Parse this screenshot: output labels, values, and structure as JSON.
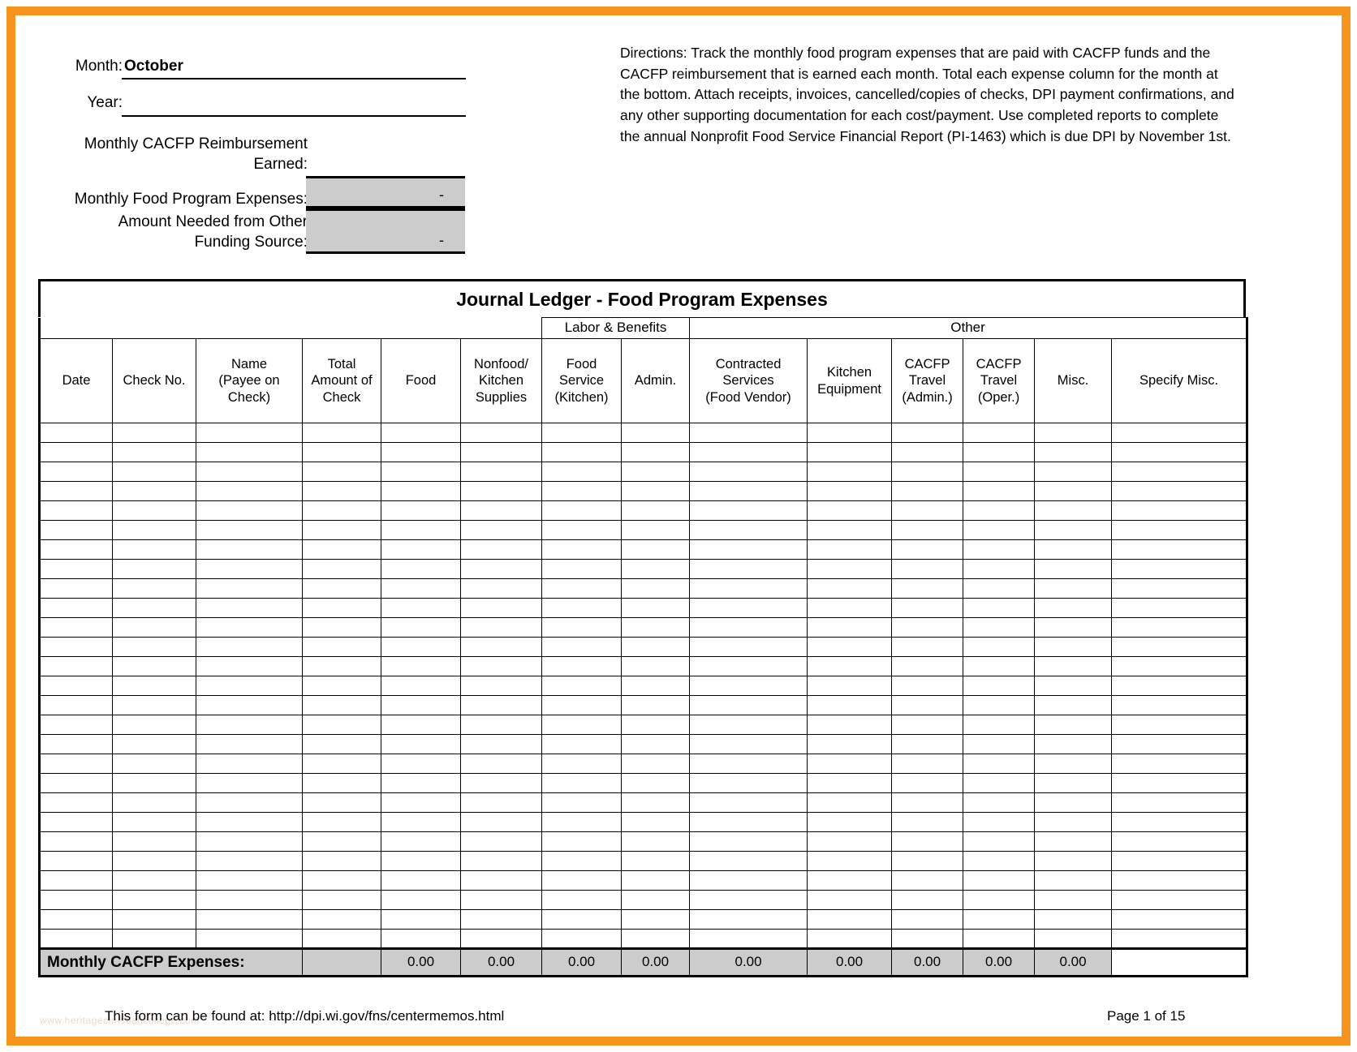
{
  "form": {
    "month_label": "Month:",
    "month_value": "October",
    "year_label": "Year:",
    "year_value": "",
    "reimbursement_label_line1": "Monthly CACFP Reimbursement",
    "reimbursement_label_line2": "Earned:",
    "reimbursement_value": "",
    "expenses_label": "Monthly Food Program Expenses:",
    "expenses_value": "-",
    "other_funding_label_line1": "Amount Needed from Other",
    "other_funding_label_line2": "Funding Source:",
    "other_funding_value": "-"
  },
  "directions": {
    "text": "Directions: Track the monthly food program expenses that are paid with CACFP funds and the CACFP reimbursement that is earned each month. Total each expense column for the month at the bottom. Attach receipts, invoices, cancelled/copies of checks, DPI payment confirmations, and any other supporting documentation for each cost/payment. Use completed reports to complete  the annual Nonprofit Food Service Financial Report (PI-1463) which is due DPI by November 1st."
  },
  "ledger": {
    "title": "Journal Ledger - Food Program Expenses",
    "group_headers": [
      {
        "label": "",
        "span": 6
      },
      {
        "label": "Labor & Benefits",
        "span": 2
      },
      {
        "label": "Other",
        "span": 6
      }
    ],
    "columns": [
      {
        "label": "Date",
        "key": "date"
      },
      {
        "label": "Check No.",
        "key": "check_no"
      },
      {
        "label": "Name\n(Payee on\nCheck)",
        "key": "name"
      },
      {
        "label": "Total\nAmount of\nCheck",
        "key": "total_amount"
      },
      {
        "label": "Food",
        "key": "food"
      },
      {
        "label": "Nonfood/\nKitchen\nSupplies",
        "key": "nonfood"
      },
      {
        "label": "Food\nService\n(Kitchen)",
        "key": "food_service"
      },
      {
        "label": "Admin.",
        "key": "admin"
      },
      {
        "label": "Contracted\nServices\n(Food Vendor)",
        "key": "contracted"
      },
      {
        "label": "Kitchen\nEquipment",
        "key": "kitchen_equipment"
      },
      {
        "label": "CACFP\nTravel\n(Admin.)",
        "key": "travel_admin"
      },
      {
        "label": "CACFP\nTravel\n(Oper.)",
        "key": "travel_oper"
      },
      {
        "label": "Misc.",
        "key": "misc"
      },
      {
        "label": "Specify Misc.",
        "key": "specify_misc"
      }
    ],
    "row_count": 27,
    "totals": {
      "label": "Monthly CACFP Expenses:",
      "values": [
        "",
        "",
        "",
        "",
        "0.00",
        "0.00",
        "0.00",
        "0.00",
        "0.00",
        "0.00",
        "0.00",
        "0.00",
        "0.00",
        ""
      ]
    }
  },
  "footer": {
    "note": "This form can be found at: http://dpi.wi.gov/fns/centermemos.html",
    "page": "Page 1 of 15",
    "watermark": "www.heritagechristiancollege.com"
  },
  "colors": {
    "page_border": "#F7941D",
    "shaded_cell": "#CCCCCC",
    "rule": "#000000"
  }
}
